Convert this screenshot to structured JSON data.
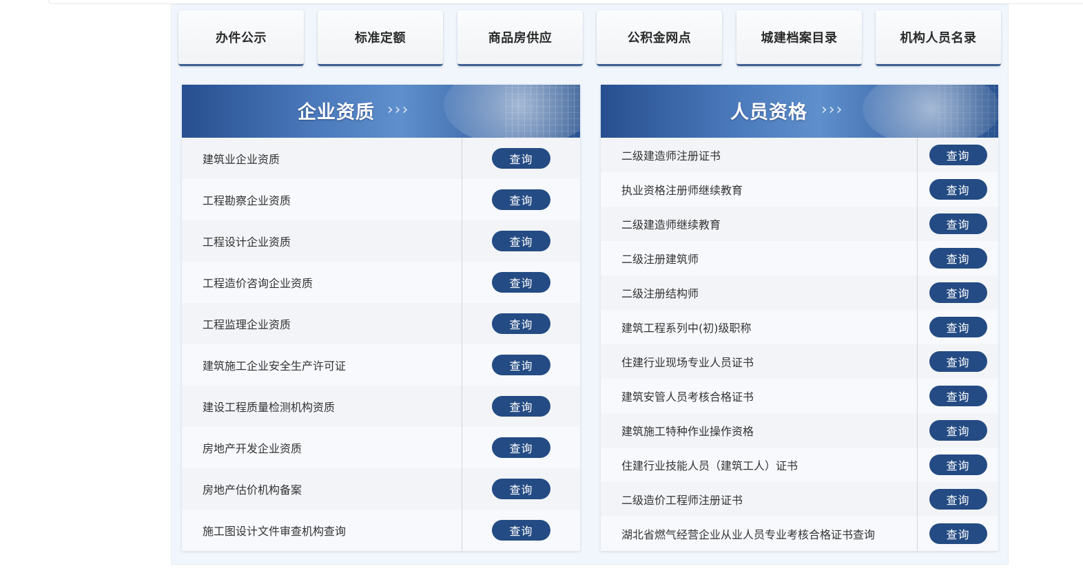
{
  "nav_tabs": [
    "办件公示",
    "标准定额",
    "商品房供应",
    "公积金网点",
    "城建档案目录",
    "机构人员名录"
  ],
  "enterprise": {
    "title": "企业资质",
    "chevrons": "›››",
    "items": [
      {
        "label": "建筑业企业资质",
        "button": "查询"
      },
      {
        "label": "工程勘察企业资质",
        "button": "查询"
      },
      {
        "label": "工程设计企业资质",
        "button": "查询"
      },
      {
        "label": "工程造价咨询企业资质",
        "button": "查询"
      },
      {
        "label": "工程监理企业资质",
        "button": "查询"
      },
      {
        "label": "建筑施工企业安全生产许可证",
        "button": "查询"
      },
      {
        "label": "建设工程质量检测机构资质",
        "button": "查询"
      },
      {
        "label": "房地产开发企业资质",
        "button": "查询"
      },
      {
        "label": "房地产估价机构备案",
        "button": "查询"
      },
      {
        "label": "施工图设计文件审查机构查询",
        "button": "查询"
      }
    ]
  },
  "personnel": {
    "title": "人员资格",
    "chevrons": "›››",
    "items": [
      {
        "label": "二级建造师注册证书",
        "button": "查询"
      },
      {
        "label": "执业资格注册师继续教育",
        "button": "查询"
      },
      {
        "label": "二级建造师继续教育",
        "button": "查询"
      },
      {
        "label": "二级注册建筑师",
        "button": "查询"
      },
      {
        "label": "二级注册结构师",
        "button": "查询"
      },
      {
        "label": "建筑工程系列中(初)级职称",
        "button": "查询"
      },
      {
        "label": "住建行业现场专业人员证书",
        "button": "查询"
      },
      {
        "label": "建筑安管人员考核合格证书",
        "button": "查询"
      },
      {
        "label": "建筑施工特种作业操作资格",
        "button": "查询"
      },
      {
        "label": "住建行业技能人员（建筑工人）证书",
        "button": "查询"
      },
      {
        "label": "二级造价工程师注册证书",
        "button": "查询"
      },
      {
        "label": "湖北省燃气经营企业从业人员专业考核合格证书查询",
        "button": "查询"
      }
    ]
  },
  "colors": {
    "accent": "#244b83",
    "banner": "#4c7bbd",
    "panel": "#f1f6fc"
  }
}
